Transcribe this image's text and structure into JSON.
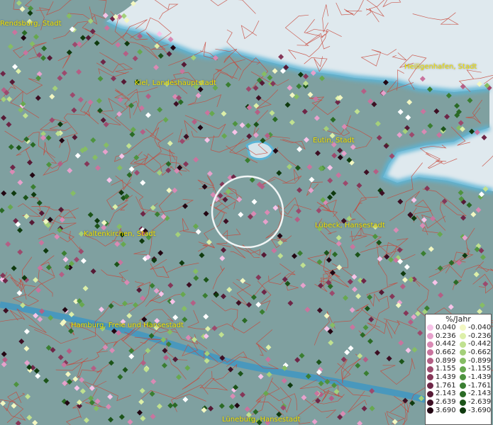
{
  "cities": [
    {
      "name": "Kiel, Landeshauptstadt"
    },
    {
      "name": "Heiligenhafen, Stadt"
    },
    {
      "name": "Eutin, Stadt"
    },
    {
      "name": "Lübeck, Hansestadt"
    },
    {
      "name": "Kaltenkirchen, Stadt"
    },
    {
      "name": "Hamburg, Freie und Hansestadt"
    },
    {
      "name": "Lüneburg, Hansestadt"
    },
    {
      "name": "Rendsburg, Stadt"
    }
  ],
  "legend": {
    "title": "%/Jahr",
    "positive": [
      "0.040",
      "0.236",
      "0.442",
      "0.662",
      "0.899",
      "1.155",
      "1.439",
      "1.761",
      "2.143",
      "2.639",
      "3.690"
    ],
    "negative": [
      "-0.040",
      "-0.236",
      "-0.442",
      "-0.662",
      "-0.899",
      "-1.155",
      "-1.439",
      "-1.761",
      "-2.143",
      "-2.639",
      "-3.690"
    ],
    "positive_colors": [
      "#f7c3e8",
      "#e6a1cc",
      "#d98ab4",
      "#c9749e",
      "#b45f85",
      "#9c4a6d",
      "#853758",
      "#6e2647",
      "#561a35",
      "#3d0f23",
      "#220612"
    ],
    "negative_colors": [
      "#f2f7c2",
      "#dcefa9",
      "#c0e190",
      "#a4d07a",
      "#86bd64",
      "#67a84f",
      "#4e933f",
      "#3a7e31",
      "#2a6a25",
      "#1c5419",
      "#0f3a0e"
    ]
  }
}
